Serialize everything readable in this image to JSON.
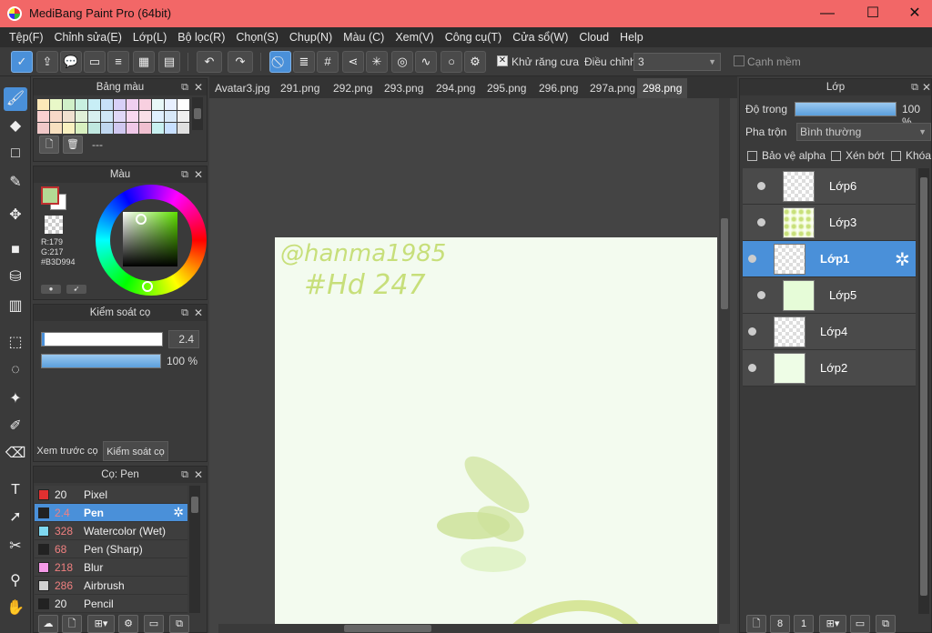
{
  "window": {
    "title": "MediBang Paint Pro (64bit)"
  },
  "menu": [
    "Tệp(F)",
    "Chỉnh sửa(E)",
    "Lớp(L)",
    "Bộ lọc(R)",
    "Chọn(S)",
    "Chụp(N)",
    "Màu (C)",
    "Xem(V)",
    "Công cụ(T)",
    "Cửa sổ(W)",
    "Cloud",
    "Help"
  ],
  "toolbar": {
    "antialias_label": "Khử răng cưa",
    "adjust_label": "Điều chỉnh",
    "adjust_value": "3",
    "soft_edge_label": "Cạnh mềm"
  },
  "palette_panel": {
    "title": "Bảng màu",
    "none_label": "---"
  },
  "color_panel": {
    "title": "Màu",
    "current_color": "#B3D994",
    "r_label": "R:179",
    "g_label": "G:217",
    "hex_label": "#B3D994"
  },
  "brush_control_panel": {
    "title": "Kiểm soát cọ",
    "size_value": "2.4",
    "opacity_value": "100 %",
    "tab_preview": "Xem trước cọ",
    "tab_control": "Kiểm soát cọ"
  },
  "brush_list_panel": {
    "title": "Cọ: Pen",
    "brushes": [
      {
        "size": "20",
        "name": "Pixel",
        "color": "#e03030"
      },
      {
        "size": "2.4",
        "name": "Pen",
        "color": "#222222"
      },
      {
        "size": "328",
        "name": "Watercolor (Wet)",
        "color": "#7fd8f0"
      },
      {
        "size": "68",
        "name": "Pen (Sharp)",
        "color": "#222222"
      },
      {
        "size": "218",
        "name": "Blur",
        "color": "#f59ae8"
      },
      {
        "size": "286",
        "name": "Airbrush",
        "color": "#cfcfcf"
      },
      {
        "size": "20",
        "name": "Pencil",
        "color": "#222222"
      }
    ]
  },
  "tabs": [
    "Avatar3.jpg",
    "291.png",
    "292.png",
    "293.png",
    "294.png",
    "295.png",
    "296.png",
    "297a.png",
    "298.png"
  ],
  "canvas": {
    "handwriting_line1": "@hanma1985",
    "handwriting_line2": "#Hd 247"
  },
  "layer_panel": {
    "title": "Lớp",
    "opacity_label": "Độ trong",
    "opacity_value": "100 %",
    "blend_label": "Pha trộn",
    "blend_value": "Bình thường",
    "protect_alpha_label": "Bảo vệ alpha",
    "clip_label": "Xén bớt",
    "lock_label": "Khóa",
    "layers": [
      {
        "name": "Lớp6"
      },
      {
        "name": "Lớp3"
      },
      {
        "name": "Lớp1"
      },
      {
        "name": "Lớp5"
      },
      {
        "name": "Lớp4"
      },
      {
        "name": "Lớp2"
      }
    ]
  }
}
